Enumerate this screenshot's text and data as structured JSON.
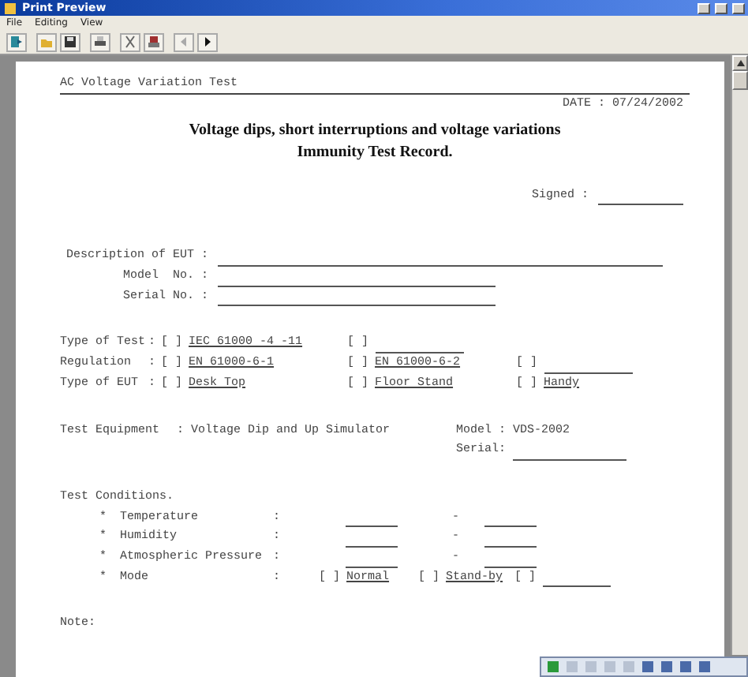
{
  "window": {
    "title": "Print Preview"
  },
  "menu": [
    {
      "label": "File"
    },
    {
      "label": "Editing"
    },
    {
      "label": "View"
    }
  ],
  "document": {
    "header": "AC Voltage Variation Test",
    "date": "DATE : 07/24/2002",
    "title_lines": [
      "Voltage dips, short interruptions and voltage variations",
      "Immunity Test Record."
    ],
    "signed": "Signed :",
    "eut_fields": [
      {
        "label": "Description of EUT :"
      },
      {
        "label": "Model  No. :"
      },
      {
        "label": "Serial No. :"
      }
    ],
    "option_rows": [
      {
        "label": "Type of Test",
        "sep": ":",
        "options": [
          {
            "box": "[ ]",
            "kind": "text",
            "text": "IEC 61000 -4 -11"
          },
          {
            "box": "[ ]",
            "kind": "blank"
          }
        ]
      },
      {
        "label": "Regulation",
        "sep": ":",
        "options": [
          {
            "box": "[ ]",
            "kind": "text",
            "text": "EN 61000-6-1"
          },
          {
            "box": "[ ]",
            "kind": "text",
            "text": "EN 61000-6-2"
          },
          {
            "box": "[ ]",
            "kind": "blank"
          }
        ]
      },
      {
        "label": "Type of EUT",
        "sep": ":",
        "options": [
          {
            "box": "[ ]",
            "kind": "text",
            "text": "Desk Top"
          },
          {
            "box": "[ ]",
            "kind": "text",
            "text": "Floor Stand"
          },
          {
            "box": "[ ]",
            "kind": "text",
            "text": "Handy"
          }
        ]
      }
    ],
    "equipment": {
      "label": "Test Equipment",
      "value": ": Voltage Dip and Up Simulator",
      "model": "Model : VDS-2002",
      "serial": "Serial:"
    },
    "conditions": {
      "title": "Test Conditions.",
      "items": [
        {
          "bullet": "*",
          "label": "Temperature",
          "sep": ":",
          "kind": "range",
          "dash": "-"
        },
        {
          "bullet": "*",
          "label": "Humidity",
          "sep": ":",
          "kind": "range",
          "dash": "-"
        },
        {
          "bullet": "*",
          "label": "Atmospheric Pressure",
          "sep": ":",
          "kind": "range",
          "dash": "-"
        },
        {
          "bullet": "*",
          "label": "Mode",
          "sep": ":",
          "kind": "options",
          "options": [
            {
              "box": "[ ]",
              "kind": "text",
              "text": "Normal"
            },
            {
              "box": "[ ]",
              "kind": "text",
              "text": "Stand-by"
            },
            {
              "box": "[ ]",
              "kind": "blank"
            }
          ]
        }
      ]
    },
    "note": "Note:"
  }
}
